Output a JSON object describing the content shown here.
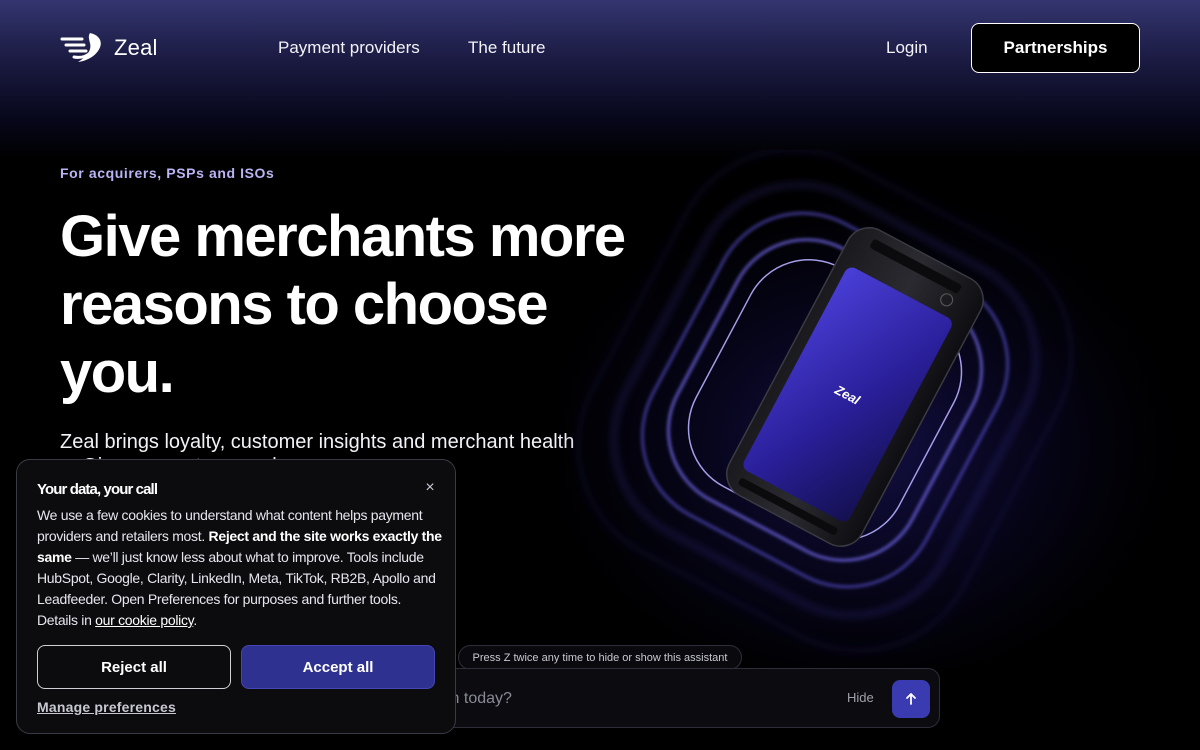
{
  "nav": {
    "logo_text": "Zeal",
    "links": [
      "Payment providers",
      "The future"
    ],
    "login_label": "Login",
    "partnerships_label": "Partnerships"
  },
  "hero": {
    "eyebrow": "For acquirers, PSPs and ISOs",
    "title": "Give merchants more reasons to choose you.",
    "subtitle": "Zeal brings loyalty, customer insights and merchant health ... Give your ... team a clearer"
  },
  "device": {
    "logo_text": "Zeal"
  },
  "assistant": {
    "hint": "Press Z twice any time to hide or show this assistant",
    "placeholder": "with today?",
    "hide_label": "Hide",
    "send_icon": "arrow-up-icon"
  },
  "cookie": {
    "title": "Your data, your call",
    "body_intro": "We use a few cookies to understand what content helps payment providers and retailers most. ",
    "body_bold": "Reject and the site works exactly the same",
    "body_rest": " — we’ll just know less about what to improve. Tools include HubSpot, Google, Clarity, LinkedIn, Meta, TikTok, RB2B, Apollo and Leadfeeder. Open Preferences for purposes and further tools. Details in ",
    "policy_link": "our cookie policy",
    "body_end": ".",
    "reject_label": "Reject all",
    "accept_label": "Accept all",
    "manage_label": "Manage preferences",
    "close_symbol": "×"
  },
  "colors": {
    "accent": "#3a3bb0",
    "eyebrow": "#b9b4f4",
    "glow": "#5a4df0"
  }
}
